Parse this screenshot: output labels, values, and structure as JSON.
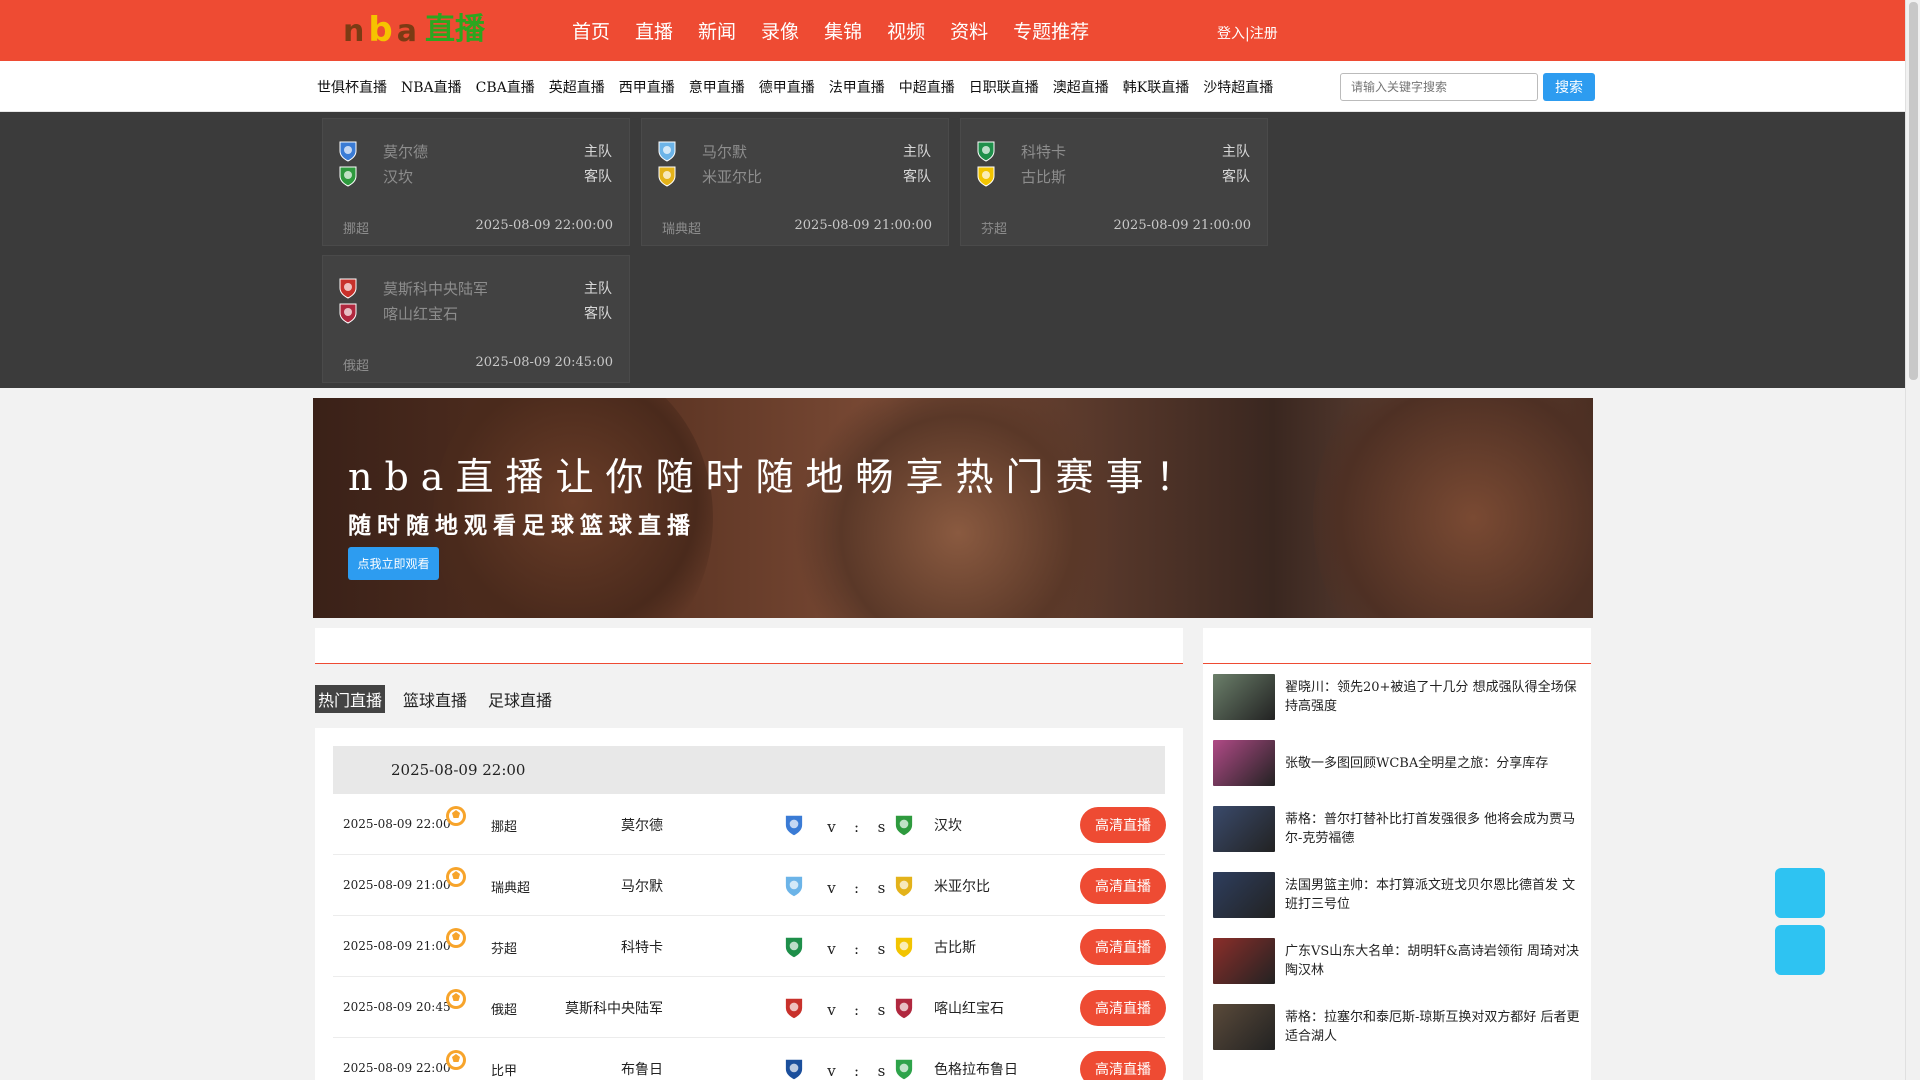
{
  "logo": {
    "c1": "n",
    "c2": "b",
    "c3": "a",
    "c4": "直播"
  },
  "mainnav": [
    "首页",
    "直播",
    "新闻",
    "录像",
    "集锦",
    "视频",
    "资料",
    "专题推荐"
  ],
  "login": "登入|注册",
  "subnav": [
    "世俱杯直播",
    "NBA直播",
    "CBA直播",
    "英超直播",
    "西甲直播",
    "意甲直播",
    "德甲直播",
    "法甲直播",
    "中超直播",
    "日职联直播",
    "澳超直播",
    "韩K联直播",
    "沙特超直播"
  ],
  "search": {
    "placeholder": "请输入关键字搜索",
    "button": "搜索"
  },
  "board": [
    {
      "home": "莫尔德",
      "away": "汉坎",
      "home_tag": "主队",
      "away_tag": "客队",
      "league": "挪超",
      "time": "2025-08-09 22:00:00",
      "home_color": "#3a7bd5",
      "away_color": "#2e9a3e"
    },
    {
      "home": "马尔默",
      "away": "米亚尔比",
      "home_tag": "主队",
      "away_tag": "客队",
      "league": "瑞典超",
      "time": "2025-08-09 21:00:00",
      "home_color": "#6cb4e8",
      "away_color": "#e3b21a"
    },
    {
      "home": "科特卡",
      "away": "古比斯",
      "home_tag": "主队",
      "away_tag": "客队",
      "league": "芬超",
      "time": "2025-08-09 21:00:00",
      "home_color": "#1e8f4a",
      "away_color": "#f2c400"
    },
    {
      "home": "莫斯科中央陆军",
      "away": "喀山红宝石",
      "home_tag": "主队",
      "away_tag": "客队",
      "league": "俄超",
      "time": "2025-08-09 20:45:00",
      "home_color": "#c8312b",
      "away_color": "#b0283f"
    }
  ],
  "banner": {
    "title": "nba直播让你随时随地畅享热门赛事！",
    "subtitle": "随时随地观看足球篮球直播",
    "button": "点我立即观看"
  },
  "tabs": [
    "热门直播",
    "篮球直播",
    "足球直播"
  ],
  "day_header": "2025-08-09 22:00",
  "matches": [
    {
      "time": "2025-08-09 22:00",
      "league": "挪超",
      "home": "莫尔德",
      "away": "汉坎",
      "v": "v",
      "colon": ":",
      "s": "s",
      "button": "高清直播",
      "home_color": "#3a7bd5",
      "away_color": "#2e9a3e"
    },
    {
      "time": "2025-08-09 21:00",
      "league": "瑞典超",
      "home": "马尔默",
      "away": "米亚尔比",
      "v": "v",
      "colon": ":",
      "s": "s",
      "button": "高清直播",
      "home_color": "#6cb4e8",
      "away_color": "#e3b21a"
    },
    {
      "time": "2025-08-09 21:00",
      "league": "芬超",
      "home": "科特卡",
      "away": "古比斯",
      "v": "v",
      "colon": ":",
      "s": "s",
      "button": "高清直播",
      "home_color": "#1e8f4a",
      "away_color": "#f2c400"
    },
    {
      "time": "2025-08-09 20:45",
      "league": "俄超",
      "home": "莫斯科中央陆军",
      "away": "喀山红宝石",
      "v": "v",
      "colon": ":",
      "s": "s",
      "button": "高清直播",
      "home_color": "#c8312b",
      "away_color": "#b0283f"
    },
    {
      "time": "2025-08-09 22:00",
      "league": "比甲",
      "home": "布鲁日",
      "away": "色格拉布鲁日",
      "v": "v",
      "colon": ":",
      "s": "s",
      "button": "高清直播",
      "home_color": "#1b4f9c",
      "away_color": "#2ea34a"
    }
  ],
  "news": [
    {
      "text": "翟晓川：领先20+被追了十几分 想成强队得全场保持高强度",
      "color": "#6b7f6a"
    },
    {
      "text": "张敬一多图回顾WCBA全明星之旅：分享库存",
      "color": "#b04a86"
    },
    {
      "text": "蒂格：普尔打替补比打首发强很多 他将会成为贾马尔-克劳福德",
      "color": "#3a4a6b"
    },
    {
      "text": "法国男篮主帅：本打算派文班戈贝尔恩比德首发 文班打三号位",
      "color": "#2e3e5e"
    },
    {
      "text": "广东VS山东大名单：胡明轩&高诗岩领衔 周琦对决陶汉林",
      "color": "#8b2e2a"
    },
    {
      "text": "蒂格：拉塞尔和泰厄斯-琼斯互换对双方都好 后者更适合湖人",
      "color": "#5a4a3a"
    }
  ]
}
